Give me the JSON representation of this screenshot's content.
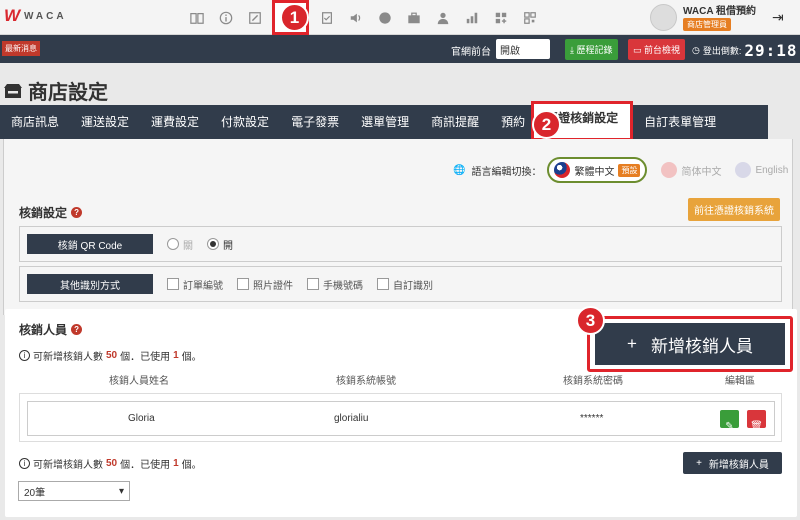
{
  "brand": {
    "mark": "W",
    "name": "WACA"
  },
  "topbar_icons": [
    "book-icon",
    "info-icon",
    "edit-icon",
    "store-icon",
    "checklist-icon",
    "speaker-icon",
    "badge-icon",
    "briefcase-icon",
    "person-icon",
    "bar-chart-icon",
    "grid-plus-icon",
    "qr-icon"
  ],
  "user": {
    "name": "WACA 租借預約",
    "role": "商店管理員"
  },
  "bar2": {
    "news": "最新消息",
    "site_label": "官網前台",
    "site_value": "開啟",
    "history_btn": "歷程記錄",
    "preview_btn": "前台檢視",
    "logout_label": "登出倒數:",
    "timer": "29:18"
  },
  "page_title": "商店設定",
  "tabs": [
    "商店訊息",
    "運送設定",
    "運費設定",
    "付款設定",
    "電子發票",
    "選單管理",
    "商訊提醒",
    "預約",
    "憑證核銷設定",
    "自訂表單管理"
  ],
  "language": {
    "label": "語言編輯切換：",
    "active": "繁體中文",
    "default_badge": "預設",
    "others": [
      "简体中文",
      "English"
    ]
  },
  "verify_settings": {
    "heading": "核銷設定",
    "go_button": "前往憑證核銷系統",
    "qr_label": "核銷 QR Code",
    "qr_options": [
      "關",
      "開"
    ],
    "qr_selected": "開",
    "other_label": "其他識別方式",
    "other_options": [
      "訂單編號",
      "照片證件",
      "手機號碼",
      "自訂識別"
    ]
  },
  "staff": {
    "heading": "核銷人員",
    "info_pre": "可新增核銷人數",
    "limit": "50",
    "info_mid": "個．已使用",
    "used": "1",
    "info_post": "個。",
    "add_button": "新增核銷人員",
    "columns": [
      "核銷人員姓名",
      "核銷系統帳號",
      "核銷系統密碼",
      "編輯區"
    ],
    "rows": [
      {
        "name": "Gloria",
        "account": "glorialiu",
        "password": "******"
      }
    ],
    "page_size": "20筆"
  },
  "callouts": [
    "1",
    "2",
    "3"
  ]
}
